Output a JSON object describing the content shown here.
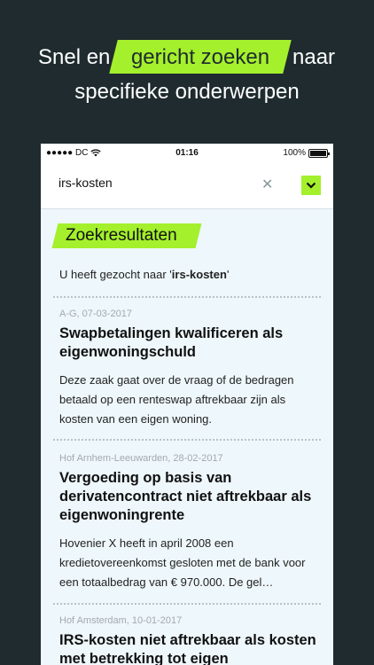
{
  "headline": {
    "line1_before": "Snel en",
    "line1_highlight": "gericht zoeken",
    "line1_after": "naar",
    "line2": "specifieke onderwerpen"
  },
  "status_bar": {
    "carrier": "●●●●● DC",
    "time": "01:16",
    "battery": "100%"
  },
  "search": {
    "query": "irs-kosten"
  },
  "results_heading": "Zoekresultaten",
  "query_summary": {
    "prefix": "U heeft gezocht naar '",
    "term": "irs-kosten",
    "suffix": "'"
  },
  "results": [
    {
      "meta": "A-G, 07-03-2017",
      "title": "Swapbetalingen kwalificeren als eigenwoningschuld",
      "snippet": "Deze zaak gaat over de vraag of de bedragen betaald op een renteswap aftrekbaar zijn als kosten van een eigen woning."
    },
    {
      "meta": "Hof Arnhem-Leeuwarden, 28-02-2017",
      "title": "Vergoeding op basis van derivatencontract niet aftrekbaar als eigenwoningrente",
      "snippet": "Hovenier X heeft in april 2008 een kredietovereenkomst gesloten met de bank voor een totaalbedrag van € 970.000. De gel…"
    },
    {
      "meta": "Hof Amsterdam, 10-01-2017",
      "title": "IRS-kosten niet aftrekbaar als kosten met betrekking tot eigen",
      "snippet": ""
    }
  ],
  "colors": {
    "background": "#1f2b2f",
    "accent": "#a4f02c",
    "panel": "#eef7fb",
    "meta_text": "#a2aab0"
  }
}
